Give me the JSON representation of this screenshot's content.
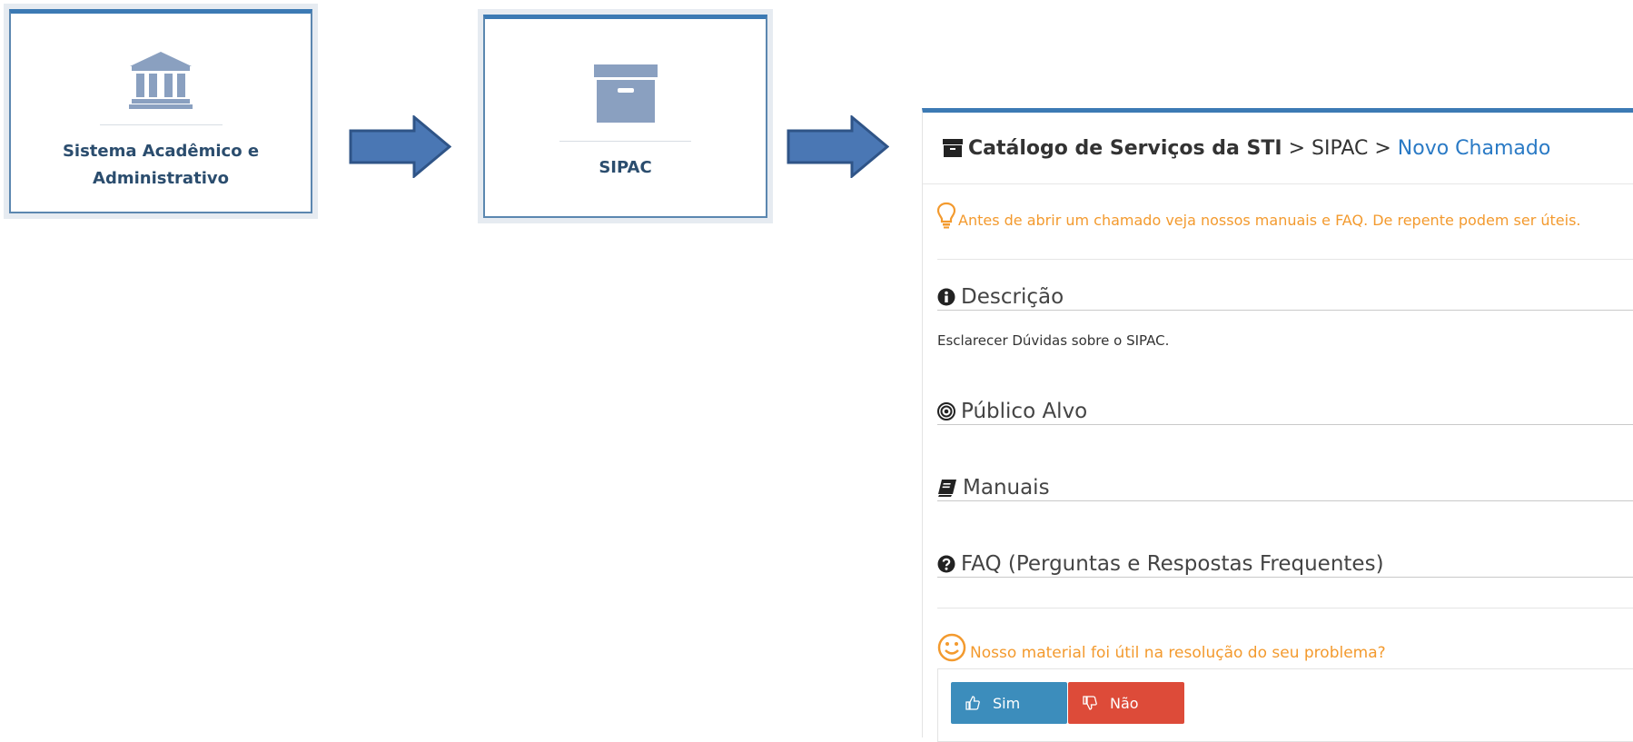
{
  "step1": {
    "icon": "bank-icon",
    "label_line1": "Sistema Acadêmico e",
    "label_line2": "Administrativo"
  },
  "step2": {
    "icon": "archive-box-icon",
    "label": "SIPAC"
  },
  "panel": {
    "breadcrumb": {
      "icon": "archive-icon",
      "root": "Catálogo de Serviços da STI",
      "sep1": ">",
      "middle": "SIPAC",
      "sep2": ">",
      "current": "Novo Chamado"
    },
    "tip": {
      "icon": "lightbulb-icon",
      "text": "Antes de abrir um chamado veja nossos manuais e FAQ. De repente podem ser úteis."
    },
    "sections": {
      "descricao": {
        "icon": "info-circle-icon",
        "title": "Descrição",
        "text": "Esclarecer Dúvidas sobre o SIPAC."
      },
      "publico": {
        "icon": "bullseye-icon",
        "title": "Público Alvo"
      },
      "manuais": {
        "icon": "book-icon",
        "title": "Manuais"
      },
      "faq": {
        "icon": "question-circle-icon",
        "title": "FAQ (Perguntas e Respostas Frequentes)"
      }
    },
    "feedback": {
      "icon": "smile-icon",
      "question": "Nosso material foi útil na resolução do seu problema?",
      "yes_label": "Sim",
      "no_label": "Não"
    }
  },
  "colors": {
    "accent": "#3c7ab4",
    "link": "#2a7ac5",
    "warning": "#f39a2e",
    "yes": "#3c8dbc",
    "no": "#dd4b39",
    "arrow": "#4a77b4"
  }
}
